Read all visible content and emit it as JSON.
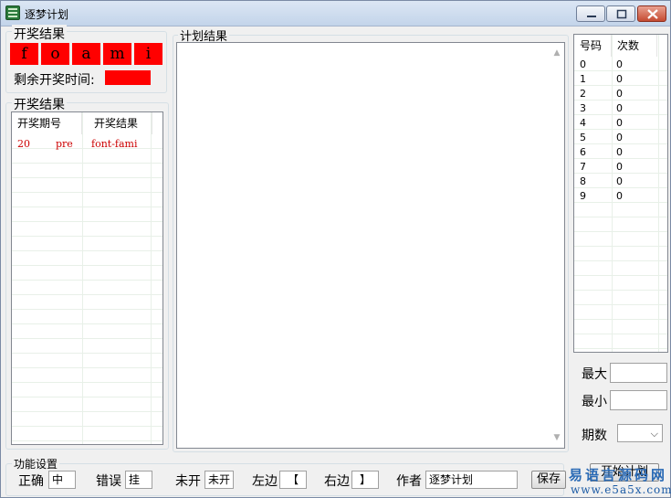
{
  "window": {
    "title": "逐梦计划"
  },
  "draw": {
    "group_label": "开奖结果",
    "balls": [
      "f",
      "o",
      "a",
      "m",
      "i"
    ],
    "countdown_label": "剩余开奖时间:"
  },
  "history": {
    "group_label": "开奖结果",
    "columns": [
      "开奖期号",
      "开奖结果"
    ],
    "rows": [
      {
        "period": "20",
        "mid": "pre",
        "result": "font-fami"
      }
    ]
  },
  "plan": {
    "group_label": "计划结果"
  },
  "stats": {
    "columns": [
      "号码",
      "次数"
    ],
    "rows": [
      {
        "num": "0",
        "count": "0"
      },
      {
        "num": "1",
        "count": "0"
      },
      {
        "num": "2",
        "count": "0"
      },
      {
        "num": "3",
        "count": "0"
      },
      {
        "num": "4",
        "count": "0"
      },
      {
        "num": "5",
        "count": "0"
      },
      {
        "num": "6",
        "count": "0"
      },
      {
        "num": "7",
        "count": "0"
      },
      {
        "num": "8",
        "count": "0"
      },
      {
        "num": "9",
        "count": "0"
      }
    ]
  },
  "side": {
    "max_label": "最大",
    "min_label": "最小",
    "period_label": "期数"
  },
  "settings": {
    "group_label": "功能设置",
    "correct_label": "正确",
    "correct_value": "中",
    "wrong_label": "错误",
    "wrong_value": "挂",
    "notopen_label": "未开",
    "notopen_value": "未开",
    "left_label": "左边",
    "left_value": "【",
    "right_label": "右边",
    "right_value": "】",
    "author_label": "作者",
    "author_value": "逐梦计划",
    "save_label": "保存",
    "start_label": "开始计划"
  },
  "watermark": {
    "cn": "易语言源码网",
    "url": "www.e5a5x.com"
  }
}
